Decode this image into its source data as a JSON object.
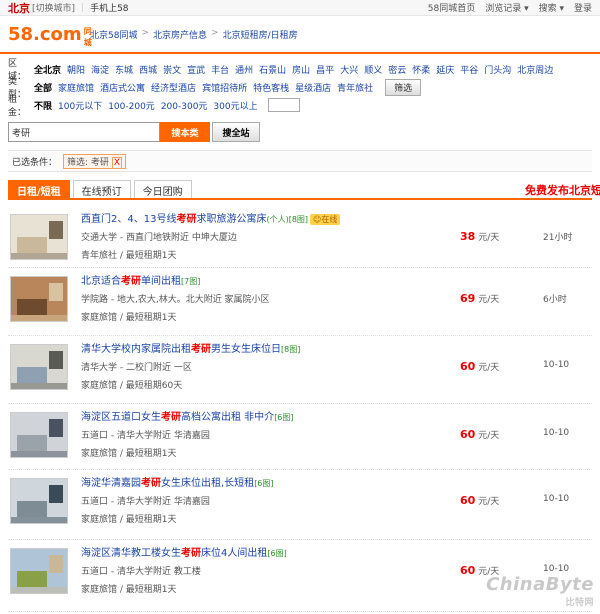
{
  "topbar": {
    "city": "北京",
    "switch": "[切换城市]",
    "mobile": "手机上58",
    "links": [
      "58同城首页",
      "浏览记录 ▾",
      "搜索 ▾",
      "登录"
    ]
  },
  "logo": {
    "main": "58.com",
    "sub": "同城"
  },
  "breadcrumb": [
    "北京58同城",
    "北京房产信息",
    "北京短租房/日租房"
  ],
  "filters": {
    "region_label": "区域：",
    "regions": [
      "全北京",
      "朝阳",
      "海淀",
      "东城",
      "西城",
      "崇文",
      "宣武",
      "丰台",
      "通州",
      "石景山",
      "房山",
      "昌平",
      "大兴",
      "顺义",
      "密云",
      "怀柔",
      "延庆",
      "平谷",
      "门头沟",
      "北京周边"
    ],
    "type_label": "类型：",
    "types": [
      "全部",
      "家庭旅馆",
      "酒店式公寓",
      "经济型酒店",
      "宾馆招待所",
      "特色客栈",
      "星级酒店",
      "青年旅社"
    ],
    "type_button": "筛选",
    "price_label": "租金：",
    "prices": [
      "不限",
      "100元以下",
      "100-200元",
      "200-300元",
      "300元以上"
    ]
  },
  "search": {
    "value": "考研",
    "button_primary": "搜本类",
    "button_secondary": "搜全站"
  },
  "selected": {
    "label": "已选条件：",
    "tag": "筛选: 考研",
    "remove": "X"
  },
  "tabs": [
    "日租/短租",
    "在线预订",
    "今日团购"
  ],
  "free_post": "免费发布北京短",
  "listings": [
    {
      "t1": "西直门2、4、13号线",
      "kw": "考研",
      "t2": "求职旅游公寓床",
      "personal": "(个人)",
      "pics": "[8图]",
      "online": "在线",
      "loc": "交通大学 - 西直门地铁附近  中坤大厦边",
      "meta": "青年旅社 / 最短租期1天",
      "price": "38",
      "unit": "元/天",
      "time": "21小时"
    },
    {
      "t1": "北京适合",
      "kw": "考研",
      "t2": "单间出租",
      "personal": "",
      "pics": "[7图]",
      "online": "",
      "loc": "学院路 - 地大,农大,林大。北大附近  家属院小区",
      "meta": "家庭旅馆 / 最短租期1天",
      "price": "69",
      "unit": "元/天",
      "time": "6小时"
    },
    {
      "t1": "清华大学校内家属院出租",
      "kw": "考研",
      "t2": "男生女生床位日",
      "personal": "",
      "pics": "[8图]",
      "online": "",
      "loc": "清华大学 - 二校门附近  一区",
      "meta": "家庭旅馆 / 最短租期60天",
      "price": "60",
      "unit": "元/天",
      "time": "10-10"
    },
    {
      "t1": "海淀区五道口女生",
      "kw": "考研",
      "t2": "高档公寓出租  非中介",
      "personal": "",
      "pics": "[6图]",
      "online": "",
      "loc": "五道口 - 清华大学附近  华清嘉园",
      "meta": "家庭旅馆 / 最短租期1天",
      "price": "60",
      "unit": "元/天",
      "time": "10-10"
    },
    {
      "t1": "海淀华清嘉园",
      "kw": "考研",
      "t2": "女生床位出租,长短租",
      "personal": "",
      "pics": "[6图]",
      "online": "",
      "loc": "五道口 - 清华大学附近  华清嘉园",
      "meta": "家庭旅馆 / 最短租期1天",
      "price": "60",
      "unit": "元/天",
      "time": "10-10"
    },
    {
      "t1": "海淀区清华教工楼女生",
      "kw": "考研",
      "t2": "床位4人间出租",
      "personal": "",
      "pics": "[6图]",
      "online": "",
      "loc": "五道口 - 清华大学附近  教工楼",
      "meta": "家庭旅馆 / 最短租期1天",
      "price": "60",
      "unit": "元/天",
      "time": "10-10"
    }
  ],
  "watermark": {
    "en": "ChinaByte",
    "cn": "比特网"
  }
}
